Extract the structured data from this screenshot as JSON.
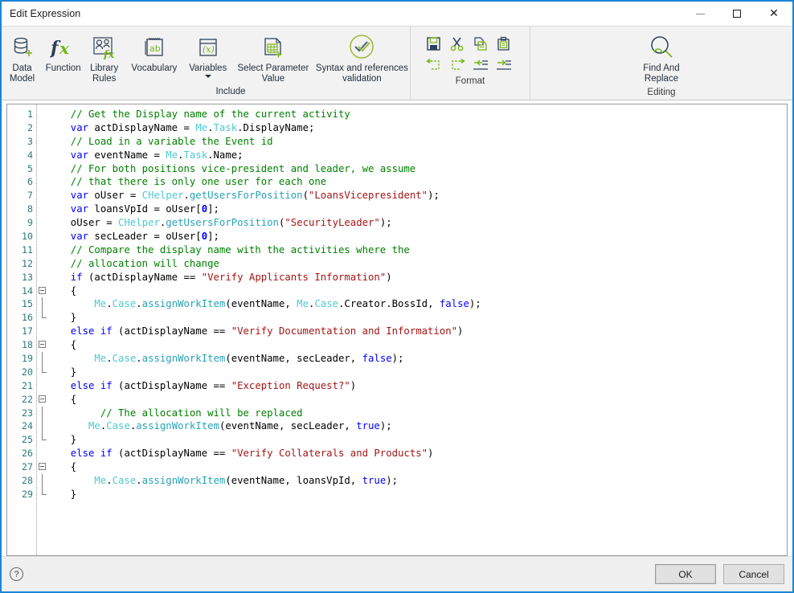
{
  "window": {
    "title": "Edit Expression",
    "controls": {
      "minimize": "minimize-icon",
      "maximize": "maximize-icon",
      "close": "close-icon"
    },
    "accent_color": "#1a85d6"
  },
  "ribbon": {
    "groups": [
      {
        "caption": "Include",
        "buttons": [
          {
            "label": "Data\nModel",
            "icon": "database-add-icon"
          },
          {
            "label": "Function",
            "icon": "fx-icon"
          },
          {
            "label": "Library\nRules",
            "icon": "library-rules-icon"
          },
          {
            "label": "Vocabulary",
            "icon": "vocabulary-notepad-icon"
          },
          {
            "label": "Variables",
            "icon": "variables-x-icon",
            "has_dropdown": true
          },
          {
            "label": "Select Parameter\nValue",
            "icon": "select-parameter-grid-icon"
          },
          {
            "label": "Syntax and references\nvalidation",
            "icon": "syntax-check-icon"
          }
        ]
      },
      {
        "caption": "Format",
        "buttons": [
          {
            "label": "Save",
            "icon": "save-icon"
          },
          {
            "label": "Cut",
            "icon": "cut-icon"
          },
          {
            "label": "Copy",
            "icon": "copy-icon"
          },
          {
            "label": "Paste",
            "icon": "paste-icon"
          },
          {
            "label": "Undo",
            "icon": "undo-icon"
          },
          {
            "label": "Redo",
            "icon": "redo-icon"
          },
          {
            "label": "Decrease Indent",
            "icon": "outdent-icon"
          },
          {
            "label": "Increase Indent",
            "icon": "indent-icon"
          }
        ]
      },
      {
        "caption": "Editing",
        "buttons": [
          {
            "label": "Find And\nReplace",
            "icon": "find-replace-icon"
          }
        ]
      }
    ]
  },
  "editor": {
    "line_numbers": [
      1,
      2,
      3,
      4,
      5,
      6,
      7,
      8,
      9,
      10,
      11,
      12,
      13,
      14,
      15,
      16,
      17,
      18,
      19,
      20,
      21,
      22,
      23,
      24,
      25,
      26,
      27,
      28,
      29
    ],
    "colors": {
      "comment": "#008000",
      "keyword": "#0000ff",
      "string": "#a31515",
      "type": "#4ec9cf",
      "method": "#27a3b5",
      "number": "#0000ff",
      "line_number": "#2b7a78"
    },
    "lines": [
      {
        "n": 1,
        "fold": "none",
        "tokens": [
          {
            "t": "comment",
            "v": "  // Get the Display name of the current activity"
          }
        ]
      },
      {
        "n": 2,
        "fold": "none",
        "tokens": [
          {
            "t": "kw",
            "v": "  var"
          },
          {
            "t": "txt",
            "v": " actDisplayName = "
          },
          {
            "t": "type",
            "v": "Me"
          },
          {
            "t": "txt",
            "v": "."
          },
          {
            "t": "type",
            "v": "Task"
          },
          {
            "t": "txt",
            "v": ".DisplayName;"
          }
        ]
      },
      {
        "n": 3,
        "fold": "none",
        "tokens": [
          {
            "t": "comment",
            "v": "  // Load in a variable the Event id"
          }
        ]
      },
      {
        "n": 4,
        "fold": "none",
        "tokens": [
          {
            "t": "kw",
            "v": "  var"
          },
          {
            "t": "txt",
            "v": " eventName = "
          },
          {
            "t": "type",
            "v": "Me"
          },
          {
            "t": "txt",
            "v": "."
          },
          {
            "t": "type",
            "v": "Task"
          },
          {
            "t": "txt",
            "v": ".Name;"
          }
        ]
      },
      {
        "n": 5,
        "fold": "none",
        "tokens": [
          {
            "t": "comment",
            "v": "  // For both positions vice-president and leader, we assume"
          }
        ]
      },
      {
        "n": 6,
        "fold": "none",
        "tokens": [
          {
            "t": "comment",
            "v": "  // that there is only one user for each one"
          }
        ]
      },
      {
        "n": 7,
        "fold": "none",
        "tokens": [
          {
            "t": "kw",
            "v": "  var"
          },
          {
            "t": "txt",
            "v": " oUser = "
          },
          {
            "t": "type",
            "v": "CHelper"
          },
          {
            "t": "txt",
            "v": "."
          },
          {
            "t": "mth",
            "v": "getUsersForPosition"
          },
          {
            "t": "txt",
            "v": "("
          },
          {
            "t": "str",
            "v": "\"LoansVicepresident\""
          },
          {
            "t": "txt",
            "v": ");"
          }
        ]
      },
      {
        "n": 8,
        "fold": "none",
        "tokens": [
          {
            "t": "kw",
            "v": "  var"
          },
          {
            "t": "txt",
            "v": " loansVpId = oUser["
          },
          {
            "t": "num",
            "v": "0"
          },
          {
            "t": "txt",
            "v": "];"
          }
        ]
      },
      {
        "n": 9,
        "fold": "none",
        "tokens": [
          {
            "t": "txt",
            "v": "  oUser = "
          },
          {
            "t": "type",
            "v": "CHelper"
          },
          {
            "t": "txt",
            "v": "."
          },
          {
            "t": "mth",
            "v": "getUsersForPosition"
          },
          {
            "t": "txt",
            "v": "("
          },
          {
            "t": "str",
            "v": "\"SecurityLeader\""
          },
          {
            "t": "txt",
            "v": ");"
          }
        ]
      },
      {
        "n": 10,
        "fold": "none",
        "tokens": [
          {
            "t": "kw",
            "v": "  var"
          },
          {
            "t": "txt",
            "v": " secLeader = oUser["
          },
          {
            "t": "num",
            "v": "0"
          },
          {
            "t": "txt",
            "v": "];"
          }
        ]
      },
      {
        "n": 11,
        "fold": "none",
        "tokens": [
          {
            "t": "comment",
            "v": "  // Compare the display name with the activities where the"
          }
        ]
      },
      {
        "n": 12,
        "fold": "none",
        "tokens": [
          {
            "t": "comment",
            "v": "  // allocation will change"
          }
        ]
      },
      {
        "n": 13,
        "fold": "none",
        "tokens": [
          {
            "t": "kw",
            "v": "  if"
          },
          {
            "t": "txt",
            "v": " (actDisplayName == "
          },
          {
            "t": "str",
            "v": "\"Verify Applicants Information\""
          },
          {
            "t": "txt",
            "v": ")"
          }
        ]
      },
      {
        "n": 14,
        "fold": "start",
        "tokens": [
          {
            "t": "txt",
            "v": "  {"
          }
        ]
      },
      {
        "n": 15,
        "fold": "mid",
        "tokens": [
          {
            "t": "txt",
            "v": "      "
          },
          {
            "t": "type",
            "v": "Me"
          },
          {
            "t": "txt",
            "v": "."
          },
          {
            "t": "type",
            "v": "Case"
          },
          {
            "t": "txt",
            "v": "."
          },
          {
            "t": "mth",
            "v": "assignWorkItem"
          },
          {
            "t": "txt",
            "v": "(eventName, "
          },
          {
            "t": "type",
            "v": "Me"
          },
          {
            "t": "txt",
            "v": "."
          },
          {
            "t": "type",
            "v": "Case"
          },
          {
            "t": "txt",
            "v": ".Creator.BossId, "
          },
          {
            "t": "kw",
            "v": "false"
          },
          {
            "t": "txt",
            "v": ");"
          }
        ]
      },
      {
        "n": 16,
        "fold": "end",
        "tokens": [
          {
            "t": "txt",
            "v": "  }"
          }
        ]
      },
      {
        "n": 17,
        "fold": "none",
        "tokens": [
          {
            "t": "kw",
            "v": "  else if"
          },
          {
            "t": "txt",
            "v": " (actDisplayName == "
          },
          {
            "t": "str",
            "v": "\"Verify Documentation and Information\""
          },
          {
            "t": "txt",
            "v": ")"
          }
        ]
      },
      {
        "n": 18,
        "fold": "start",
        "tokens": [
          {
            "t": "txt",
            "v": "  {"
          }
        ]
      },
      {
        "n": 19,
        "fold": "mid",
        "tokens": [
          {
            "t": "txt",
            "v": "      "
          },
          {
            "t": "type",
            "v": "Me"
          },
          {
            "t": "txt",
            "v": "."
          },
          {
            "t": "type",
            "v": "Case"
          },
          {
            "t": "txt",
            "v": "."
          },
          {
            "t": "mth",
            "v": "assignWorkItem"
          },
          {
            "t": "txt",
            "v": "(eventName, secLeader, "
          },
          {
            "t": "kw",
            "v": "false"
          },
          {
            "t": "txt",
            "v": ");"
          }
        ]
      },
      {
        "n": 20,
        "fold": "end",
        "tokens": [
          {
            "t": "txt",
            "v": "  }"
          }
        ]
      },
      {
        "n": 21,
        "fold": "none",
        "tokens": [
          {
            "t": "kw",
            "v": "  else if"
          },
          {
            "t": "txt",
            "v": " (actDisplayName == "
          },
          {
            "t": "str",
            "v": "\"Exception Request?\""
          },
          {
            "t": "txt",
            "v": ")"
          }
        ]
      },
      {
        "n": 22,
        "fold": "start",
        "tokens": [
          {
            "t": "txt",
            "v": "  {"
          }
        ]
      },
      {
        "n": 23,
        "fold": "mid",
        "tokens": [
          {
            "t": "comment",
            "v": "       // The allocation will be replaced"
          }
        ]
      },
      {
        "n": 24,
        "fold": "mid",
        "tokens": [
          {
            "t": "txt",
            "v": "     "
          },
          {
            "t": "type",
            "v": "Me"
          },
          {
            "t": "txt",
            "v": "."
          },
          {
            "t": "type",
            "v": "Case"
          },
          {
            "t": "txt",
            "v": "."
          },
          {
            "t": "mth",
            "v": "assignWorkItem"
          },
          {
            "t": "txt",
            "v": "(eventName, secLeader, "
          },
          {
            "t": "kw",
            "v": "true"
          },
          {
            "t": "txt",
            "v": ");"
          }
        ]
      },
      {
        "n": 25,
        "fold": "end",
        "tokens": [
          {
            "t": "txt",
            "v": "  }"
          }
        ]
      },
      {
        "n": 26,
        "fold": "none",
        "tokens": [
          {
            "t": "kw",
            "v": "  else if"
          },
          {
            "t": "txt",
            "v": " (actDisplayName == "
          },
          {
            "t": "str",
            "v": "\"Verify Collaterals and Products\""
          },
          {
            "t": "txt",
            "v": ")"
          }
        ]
      },
      {
        "n": 27,
        "fold": "start",
        "tokens": [
          {
            "t": "txt",
            "v": "  {"
          }
        ]
      },
      {
        "n": 28,
        "fold": "mid",
        "tokens": [
          {
            "t": "txt",
            "v": "      "
          },
          {
            "t": "type",
            "v": "Me"
          },
          {
            "t": "txt",
            "v": "."
          },
          {
            "t": "type",
            "v": "Case"
          },
          {
            "t": "txt",
            "v": "."
          },
          {
            "t": "mth",
            "v": "assignWorkItem"
          },
          {
            "t": "txt",
            "v": "(eventName, loansVpId, "
          },
          {
            "t": "kw",
            "v": "true"
          },
          {
            "t": "txt",
            "v": ");"
          }
        ]
      },
      {
        "n": 29,
        "fold": "end",
        "tokens": [
          {
            "t": "txt",
            "v": "  }"
          }
        ]
      }
    ]
  },
  "footer": {
    "help": "?",
    "ok_label": "OK",
    "cancel_label": "Cancel"
  }
}
